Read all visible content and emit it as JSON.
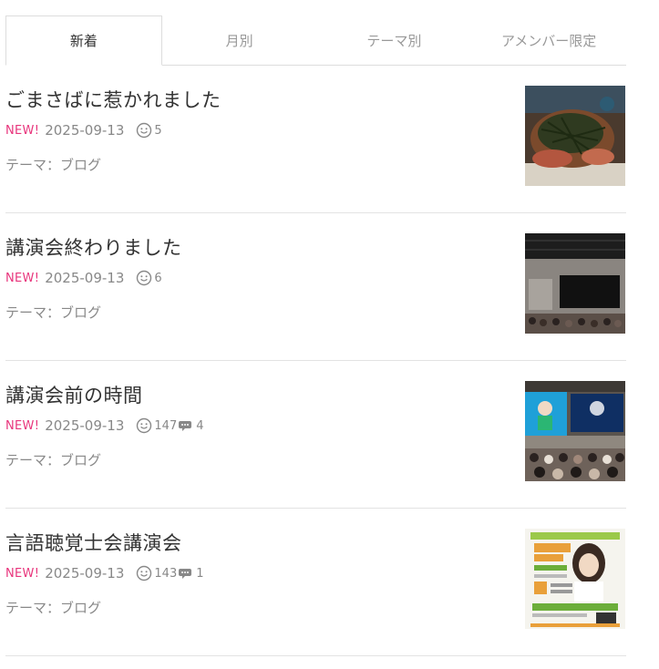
{
  "tabs": [
    {
      "label": "新着",
      "active": true
    },
    {
      "label": "月別",
      "active": false
    },
    {
      "label": "テーマ別",
      "active": false
    },
    {
      "label": "アメンバー限定",
      "active": false
    }
  ],
  "entries": [
    {
      "title": "ごまさばに惹かれました",
      "new_label": "NEW!",
      "date": "2025-09-13",
      "likes": "5",
      "comments": null,
      "theme_prefix": "テーマ：",
      "theme": "ブログ",
      "thumb_icon": "food-photo"
    },
    {
      "title": "講演会終わりました",
      "new_label": "NEW!",
      "date": "2025-09-13",
      "likes": "6",
      "comments": null,
      "theme_prefix": "テーマ：",
      "theme": "ブログ",
      "thumb_icon": "hall-photo"
    },
    {
      "title": "講演会前の時間",
      "new_label": "NEW!",
      "date": "2025-09-13",
      "likes": "147",
      "comments": "4",
      "theme_prefix": "テーマ：",
      "theme": "ブログ",
      "thumb_icon": "stage-screen-photo"
    },
    {
      "title": "言語聴覚士会講演会",
      "new_label": "NEW!",
      "date": "2025-09-13",
      "likes": "143",
      "comments": "1",
      "theme_prefix": "テーマ：",
      "theme": "ブログ",
      "thumb_icon": "poster-photo"
    }
  ],
  "colors": {
    "new_badge": "#e8357c",
    "text_main": "#333333",
    "text_muted": "#888888",
    "divider": "#e3e3e3"
  }
}
